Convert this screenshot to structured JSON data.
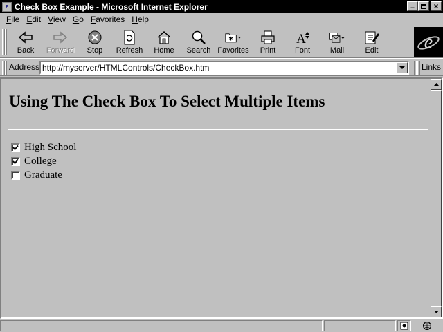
{
  "window": {
    "title": "Check Box Example - Microsoft Internet Explorer",
    "controls": {
      "minimize": "_",
      "maximize": "▫",
      "close": "×"
    }
  },
  "menu": [
    {
      "label": "File",
      "key": "F",
      "rest": "ile"
    },
    {
      "label": "Edit",
      "key": "E",
      "rest": "dit"
    },
    {
      "label": "View",
      "key": "V",
      "rest": "iew"
    },
    {
      "label": "Go",
      "key": "G",
      "rest": "o"
    },
    {
      "label": "Favorites",
      "key": "F",
      "rest": "avorites"
    },
    {
      "label": "Help",
      "key": "H",
      "rest": "elp"
    }
  ],
  "toolbar": {
    "back": "Back",
    "forward": "Forward",
    "stop": "Stop",
    "refresh": "Refresh",
    "home": "Home",
    "search": "Search",
    "favorites": "Favorites",
    "print": "Print",
    "font": "Font",
    "mail": "Mail",
    "edit": "Edit"
  },
  "address": {
    "label": "Address",
    "value": "http://myserver/HTMLControls/CheckBox.htm",
    "links_label": "Links"
  },
  "page": {
    "heading": "Using The Check Box To Select Multiple Items",
    "checkboxes": [
      {
        "label": "High School",
        "checked": true
      },
      {
        "label": "College",
        "checked": true
      },
      {
        "label": "Graduate",
        "checked": false
      }
    ]
  },
  "colors": {
    "chrome": "#c0c0c0",
    "titlebar": "#000000",
    "shadow": "#808080"
  }
}
